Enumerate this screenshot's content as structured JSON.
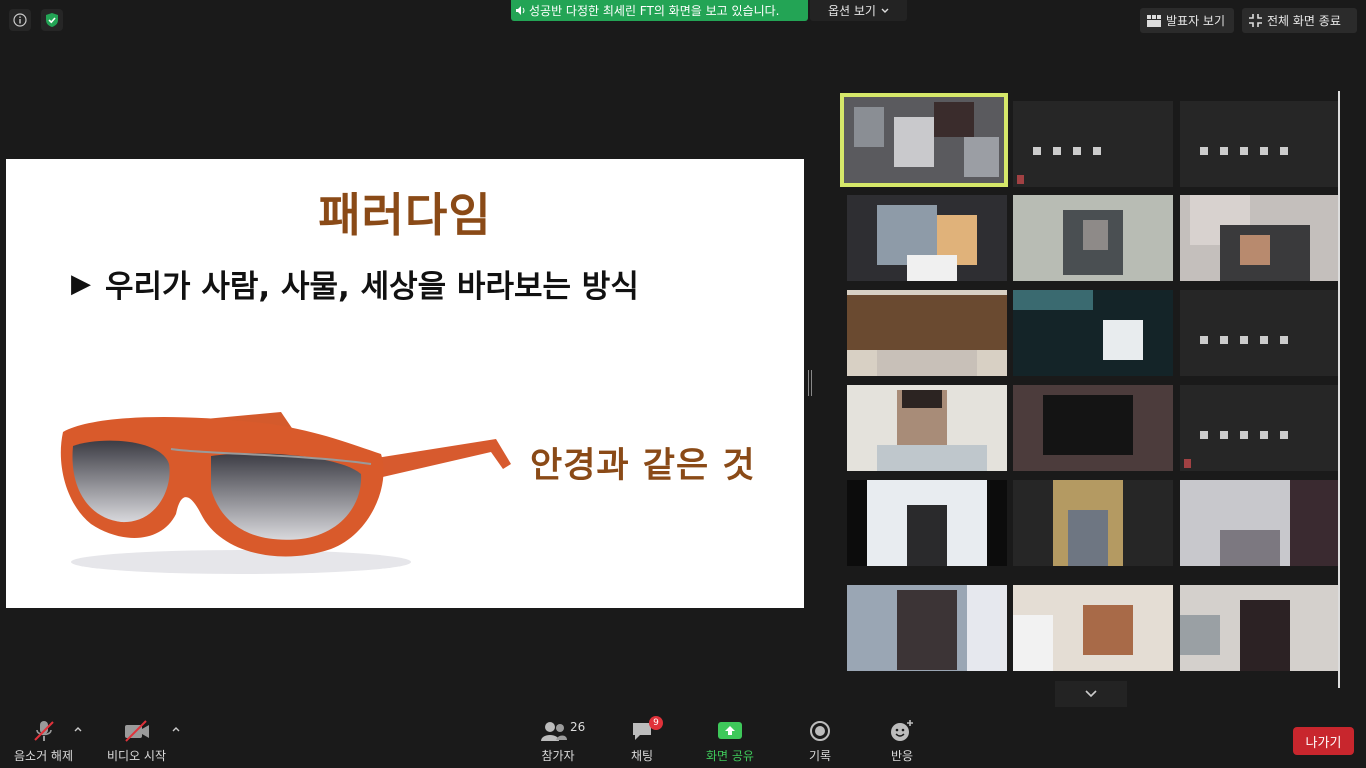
{
  "top_bar": {
    "info_icon": "info-icon",
    "security_icon": "shield-check-icon",
    "share_banner": "성공반 다정한 최세린 FT의 화면을 보고 있습니다.",
    "options_label": "옵션 보기",
    "speaker_view_label": "발표자 보기",
    "exit_fullscreen_label": "전체 화면 종료",
    "accent_green": "#23a455"
  },
  "slide": {
    "title": "패러다임",
    "bullet_marker": "▶",
    "bullet": "우리가 사람, 사물, 세상을 바라보는 방식",
    "caption": "안경과 같은 것",
    "title_color": "#8a4a17"
  },
  "toolbar": {
    "unmute_label": "음소거 해제",
    "start_video_label": "비디오 시작",
    "participants_label": "참가자",
    "participants_count": "26",
    "chat_label": "채팅",
    "chat_badge": "9",
    "share_screen_label": "화면 공유",
    "record_label": "기록",
    "reactions_label": "반응",
    "leave_label": "나가기",
    "leave_color": "#c8262d"
  }
}
